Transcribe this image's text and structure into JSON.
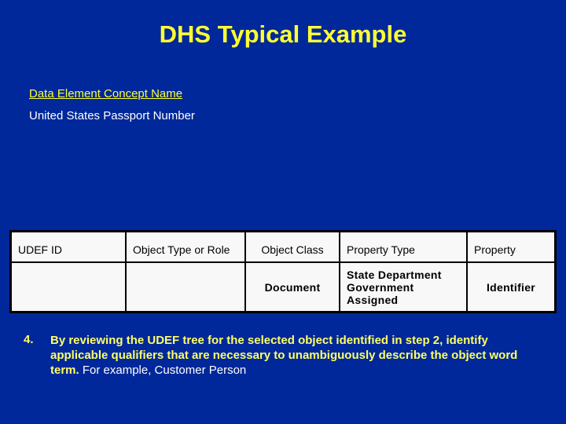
{
  "title": "DHS Typical Example",
  "concept": {
    "label": "Data Element Concept Name",
    "value": "United States Passport Number"
  },
  "table": {
    "headers": [
      "UDEF ID",
      "Object Type or Role",
      "Object Class",
      "Property Type",
      "Property"
    ],
    "row": [
      "",
      "",
      "Document",
      "State Department Government Assigned",
      "Identifier"
    ]
  },
  "step": {
    "number": "4.",
    "text": "By reviewing the UDEF tree for the selected object identified in step 2, identify applicable qualifiers that are necessary to unambiguously describe the object word term.",
    "example": " For example, Customer Person"
  },
  "colors": {
    "background": "#00289a",
    "title": "#ffff33",
    "table_bg": "#f8f8f8"
  }
}
